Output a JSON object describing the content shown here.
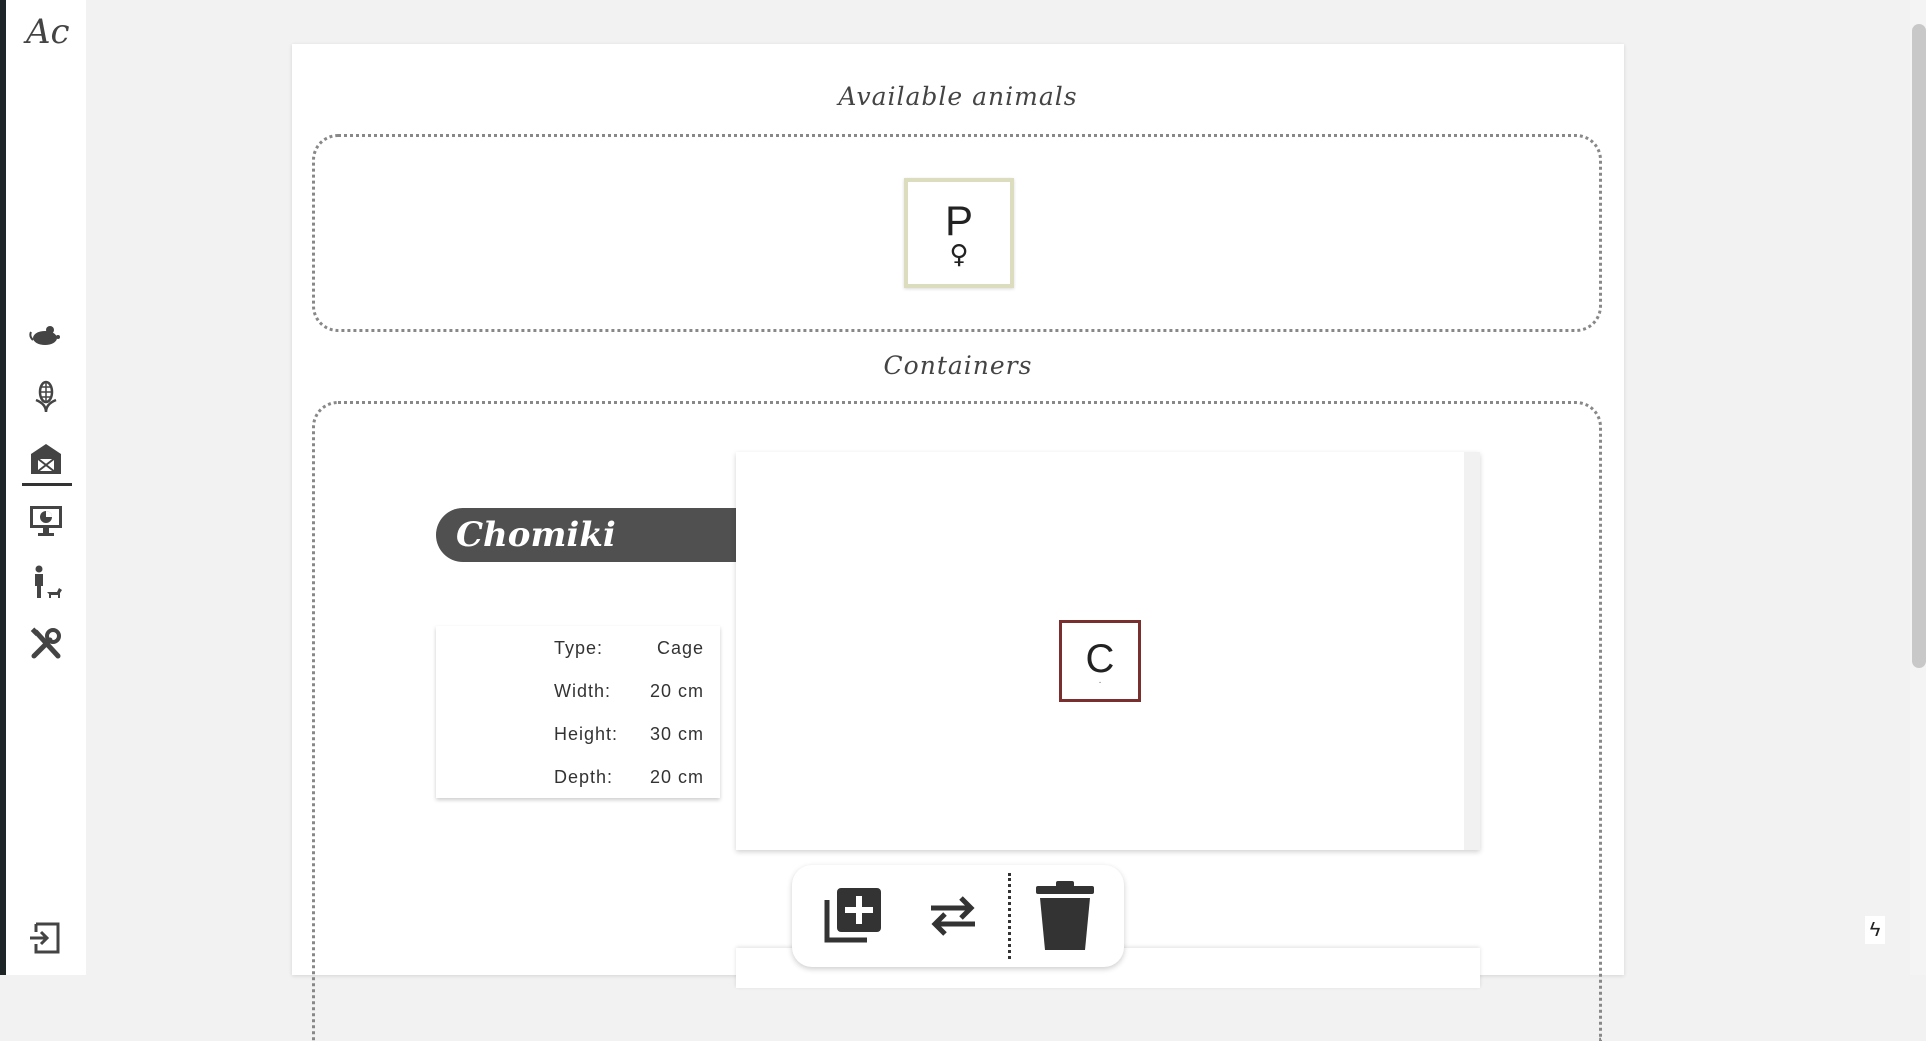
{
  "sidebar": {
    "logo": "Ac",
    "items": [
      {
        "icon": "mouse-icon"
      },
      {
        "icon": "corn-icon"
      },
      {
        "icon": "barn-icon",
        "active": true
      },
      {
        "icon": "monitor-chart-icon"
      },
      {
        "icon": "person-dog-icon"
      },
      {
        "icon": "tools-icon"
      }
    ],
    "logout_icon": "logout-icon"
  },
  "available_animals": {
    "title": "Available animals",
    "items": [
      {
        "letter": "P",
        "sex": "♀",
        "border_color": "#dcdcbe"
      }
    ]
  },
  "containers": {
    "title": "Containers",
    "items": [
      {
        "name": "Chomiki",
        "info": [
          {
            "label": "Type:",
            "value": "Cage"
          },
          {
            "label": "Width:",
            "value": "20 cm"
          },
          {
            "label": "Height:",
            "value": "30 cm"
          },
          {
            "label": "Depth:",
            "value": "20 cm"
          }
        ],
        "animals": [
          {
            "letter": "C",
            "sub": "·",
            "border_color": "#7a2f2f"
          }
        ]
      }
    ]
  },
  "actions": [
    {
      "icon": "add-copy-icon"
    },
    {
      "icon": "swap-arrows-icon"
    },
    {
      "icon": "trash-icon"
    }
  ],
  "floating_icon": "lightning-icon",
  "lightning": "ϟ"
}
